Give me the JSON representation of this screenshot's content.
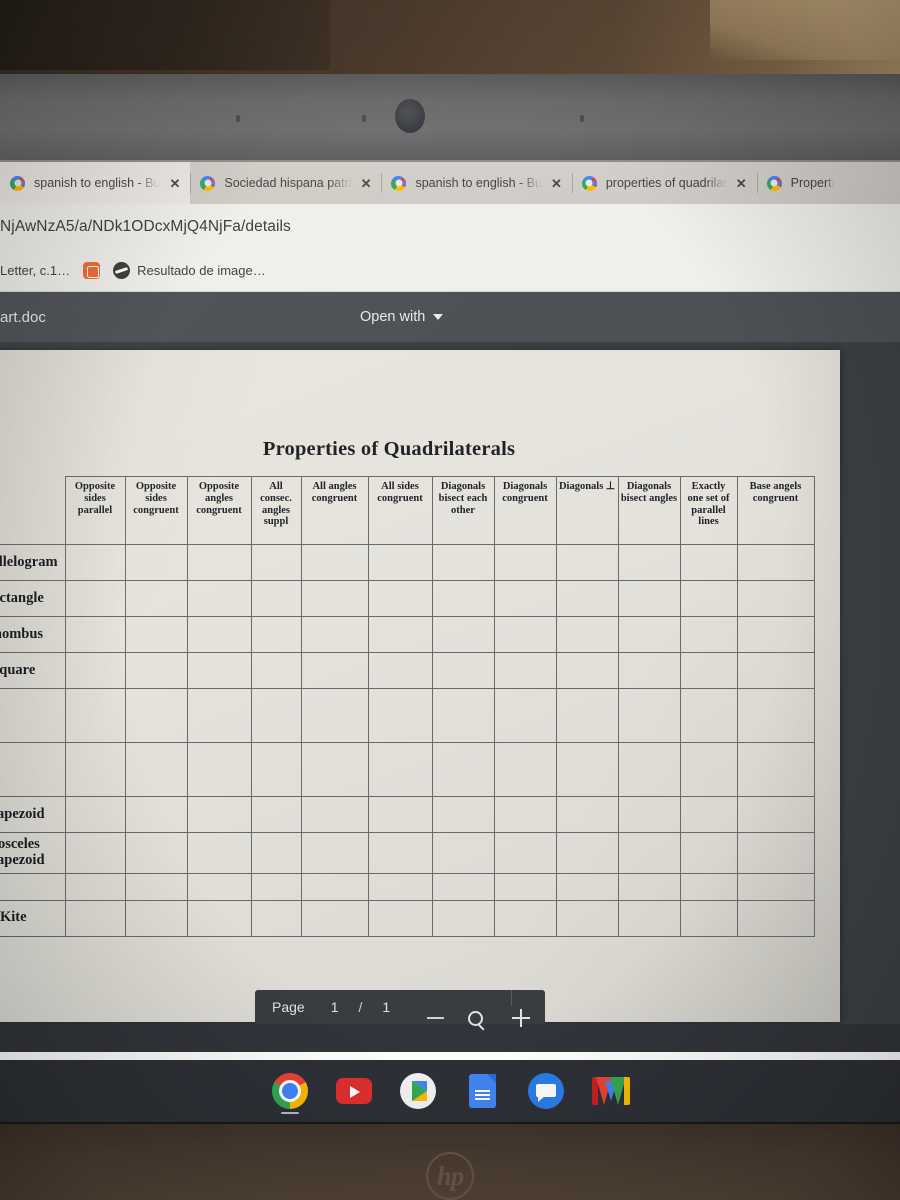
{
  "browser": {
    "tabs": [
      {
        "title": "spanish to english - Bu",
        "favicon": "google-g-icon",
        "close": "✕",
        "active": true
      },
      {
        "title": "Sociedad hispana patri",
        "favicon": "google-g-icon",
        "close": "✕",
        "active": false
      },
      {
        "title": "spanish to english - Bu",
        "favicon": "google-g-icon",
        "close": "✕",
        "active": false
      },
      {
        "title": "properties of quadrilat",
        "favicon": "google-g-icon",
        "close": "✕",
        "active": false
      },
      {
        "title": "Properti",
        "favicon": "google-g-icon",
        "close": "",
        "active": false
      }
    ],
    "url": "NjAwNzA5/a/NDk1ODcxMjQ4NjFa/details",
    "bookmarks": [
      {
        "label": "Letter, c.1…",
        "icon": "page-icon"
      },
      {
        "label": "",
        "icon": "blogger-icon"
      },
      {
        "label": "Resultado de image…",
        "icon": "globe-icon"
      }
    ]
  },
  "doc_viewer": {
    "file_name": "art.doc",
    "open_with_label": "Open with",
    "page_label": "Page",
    "page_current": "1",
    "page_separator": "/",
    "page_total": "1",
    "zoom_out_icon": "minus-icon",
    "zoom_icon": "magnifier-icon",
    "zoom_in_icon": "plus-icon"
  },
  "document": {
    "title": "Properties of Quadrilaterals",
    "table": {
      "columns": [
        "Opposite sides parallel",
        "Opposite sides congruent",
        "Opposite angles congruent",
        "All consec. angles suppl",
        "All angles congruent",
        "All sides congruent",
        "Diagonals bisect each other",
        "Diagonals congruent",
        "Diagonals ⊥",
        "Diagonals bisect angles",
        "Exactly one set of parallel lines",
        "Base angels congruent"
      ],
      "rows": [
        {
          "label": "Parallelogram",
          "height": "normal"
        },
        {
          "label": "Rectangle",
          "height": "normal"
        },
        {
          "label": "Rhombus",
          "height": "normal"
        },
        {
          "label": "Square",
          "height": "normal"
        },
        {
          "label": "",
          "height": "tall"
        },
        {
          "label": "",
          "height": "tall"
        },
        {
          "label": "Trapezoid",
          "height": "normal"
        },
        {
          "label": "Isosceles Trapezoid",
          "height": "normal"
        },
        {
          "label": "",
          "height": "short"
        },
        {
          "label": "Kite",
          "height": "normal"
        }
      ]
    }
  },
  "shelf": {
    "icons": [
      "chrome-icon",
      "youtube-icon",
      "play-store-icon",
      "google-docs-icon",
      "google-chat-icon",
      "gmail-icon"
    ]
  },
  "hardware": {
    "brand_logo": "hp",
    "webcam": "webcam-lens"
  }
}
